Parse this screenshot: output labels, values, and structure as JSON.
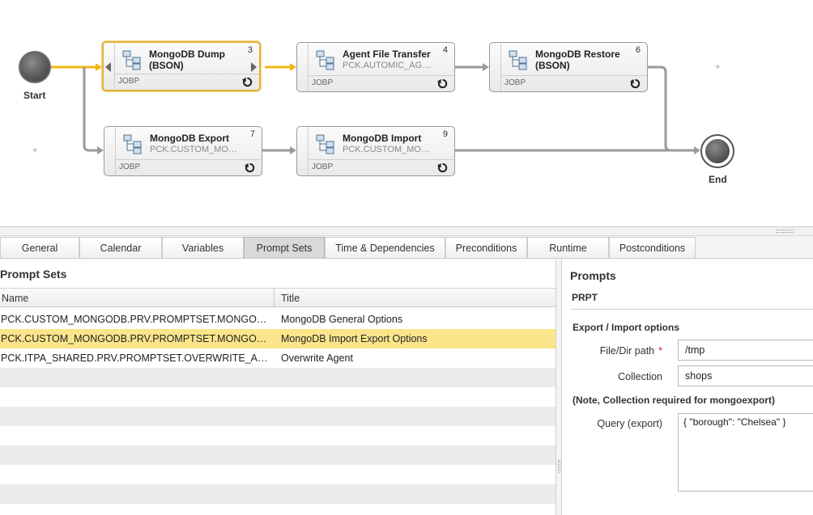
{
  "workflow": {
    "start_label": "Start",
    "end_label": "End",
    "tasks": [
      {
        "title_line1": "MongoDB Dump",
        "title_line2": "(BSON)",
        "subtitle": "",
        "number": "3",
        "type": "JOBP",
        "selected": true
      },
      {
        "title_line1": "Agent File Transfer",
        "title_line2": "",
        "subtitle": "PCK.AUTOMIC_AGE...",
        "number": "4",
        "type": "JOBP",
        "selected": false
      },
      {
        "title_line1": "MongoDB Restore",
        "title_line2": "(BSON)",
        "subtitle": "",
        "number": "6",
        "type": "JOBP",
        "selected": false
      },
      {
        "title_line1": "MongoDB Export",
        "title_line2": "",
        "subtitle": "PCK.CUSTOM_MON...",
        "number": "7",
        "type": "JOBP",
        "selected": false
      },
      {
        "title_line1": "MongoDB Import",
        "title_line2": "",
        "subtitle": "PCK.CUSTOM_MON...",
        "number": "9",
        "type": "JOBP",
        "selected": false
      }
    ],
    "colors": {
      "active_link": "#f2b616",
      "link": "#9a9a9a",
      "selected_border": "#e3b33a"
    }
  },
  "tabs": [
    {
      "label": "General",
      "active": false
    },
    {
      "label": "Calendar",
      "active": false
    },
    {
      "label": "Variables",
      "active": false
    },
    {
      "label": "Prompt Sets",
      "active": true
    },
    {
      "label": "Time & Dependencies",
      "active": false
    },
    {
      "label": "Preconditions",
      "active": false
    },
    {
      "label": "Runtime",
      "active": false
    },
    {
      "label": "Postconditions",
      "active": false
    }
  ],
  "prompt_sets": {
    "heading": "Prompt Sets",
    "columns": {
      "name": "Name",
      "title": "Title"
    },
    "rows": [
      {
        "name": "PCK.CUSTOM_MONGODB.PRV.PROMPTSET.MONGODB...",
        "title": "MongoDB General Options",
        "selected": false
      },
      {
        "name": "PCK.CUSTOM_MONGODB.PRV.PROMPTSET.MONGODB...",
        "title": "MongoDB Import Export Options",
        "selected": true
      },
      {
        "name": "PCK.ITPA_SHARED.PRV.PROMPTSET.OVERWRITE_AGE...",
        "title": "Overwrite Agent",
        "selected": false
      }
    ],
    "selected_color": "#fbe58b"
  },
  "prompts": {
    "heading": "Prompts",
    "prpt": "PRPT",
    "section_export_import": "Export / Import options",
    "file_dir_label": "File/Dir path",
    "file_dir_required": "*",
    "file_dir_value": "/tmp",
    "collection_label": "Collection",
    "collection_value": "shops",
    "note": "(Note, Collection required for mongoexport)",
    "query_label": "Query (export)",
    "query_value": "{ \"borough\": \"Chelsea\" }"
  }
}
